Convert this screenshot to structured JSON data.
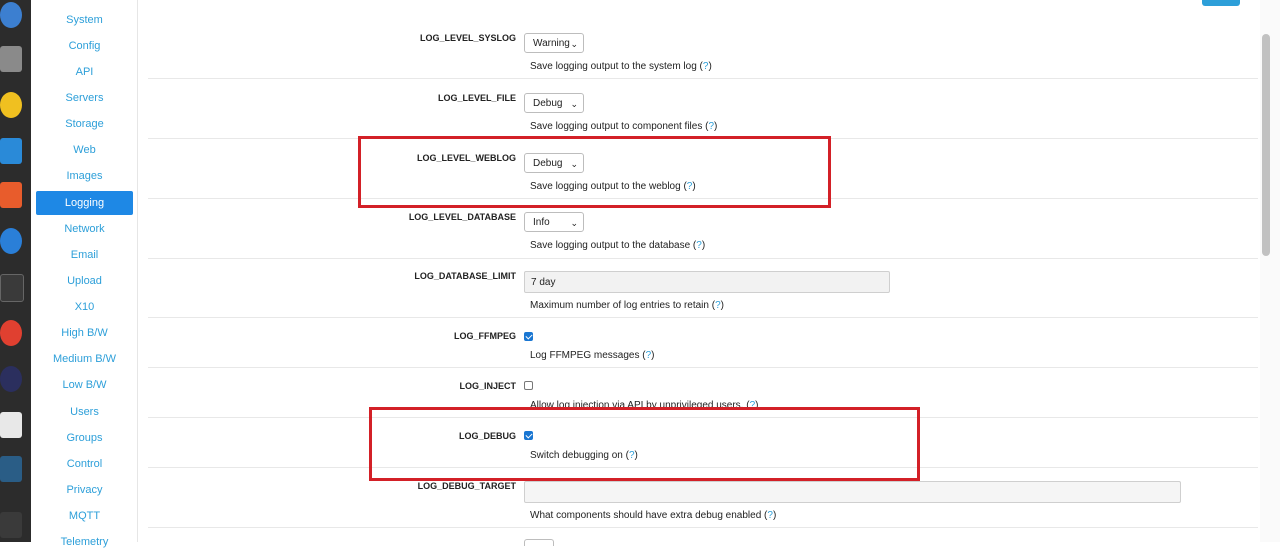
{
  "sidebar": {
    "items": [
      {
        "label": "System",
        "active": false
      },
      {
        "label": "Config",
        "active": false
      },
      {
        "label": "API",
        "active": false
      },
      {
        "label": "Servers",
        "active": false
      },
      {
        "label": "Storage",
        "active": false
      },
      {
        "label": "Web",
        "active": false
      },
      {
        "label": "Images",
        "active": false
      },
      {
        "label": "Logging",
        "active": true
      },
      {
        "label": "Network",
        "active": false
      },
      {
        "label": "Email",
        "active": false
      },
      {
        "label": "Upload",
        "active": false
      },
      {
        "label": "X10",
        "active": false
      },
      {
        "label": "High B/W",
        "active": false
      },
      {
        "label": "Medium B/W",
        "active": false
      },
      {
        "label": "Low B/W",
        "active": false
      },
      {
        "label": "Users",
        "active": false
      },
      {
        "label": "Groups",
        "active": false
      },
      {
        "label": "Control",
        "active": false
      },
      {
        "label": "Privacy",
        "active": false
      },
      {
        "label": "MQTT",
        "active": false
      },
      {
        "label": "Telemetry",
        "active": false
      }
    ]
  },
  "dock": {
    "icons": [
      "thunderbird-icon",
      "files-icon",
      "rhythmbox-icon",
      "writer-icon",
      "app-center-icon",
      "help-icon",
      "terminal-icon",
      "chrome-icon",
      "eclipse-icon",
      "text-editor-icon",
      "mysql-workbench-icon",
      "app-grid-icon"
    ]
  },
  "options": [
    {
      "key": "LOG_LEVEL_SYSLOG",
      "control": "select",
      "value": "Warning",
      "desc": "Save logging output to the system log",
      "help": "?"
    },
    {
      "key": "LOG_LEVEL_FILE",
      "control": "select",
      "value": "Debug",
      "desc": "Save logging output to component files",
      "help": "?"
    },
    {
      "key": "LOG_LEVEL_WEBLOG",
      "control": "select",
      "value": "Debug",
      "desc": "Save logging output to the weblog",
      "help": "?"
    },
    {
      "key": "LOG_LEVEL_DATABASE",
      "control": "select",
      "value": "Info",
      "desc": "Save logging output to the database",
      "help": "?"
    },
    {
      "key": "LOG_DATABASE_LIMIT",
      "control": "text",
      "value": "7 day",
      "desc": "Maximum number of log entries to retain",
      "help": "?"
    },
    {
      "key": "LOG_FFMPEG",
      "control": "checkbox",
      "checked": true,
      "desc": "Log FFMPEG messages",
      "help": "?"
    },
    {
      "key": "LOG_INJECT",
      "control": "checkbox",
      "checked": false,
      "desc": "Allow log injection via API by unprivileged users.",
      "help": "?"
    },
    {
      "key": "LOG_DEBUG",
      "control": "checkbox",
      "checked": true,
      "desc": "Switch debugging on",
      "help": "?"
    },
    {
      "key": "LOG_DEBUG_TARGET",
      "control": "text",
      "value": "",
      "desc": "What components should have extra debug enabled",
      "help": "?"
    }
  ],
  "colors": {
    "accent": "#2d9fd9",
    "active_nav": "#1e88e5",
    "highlight": "#d32027",
    "dock_bg": "#2c2c2c"
  }
}
